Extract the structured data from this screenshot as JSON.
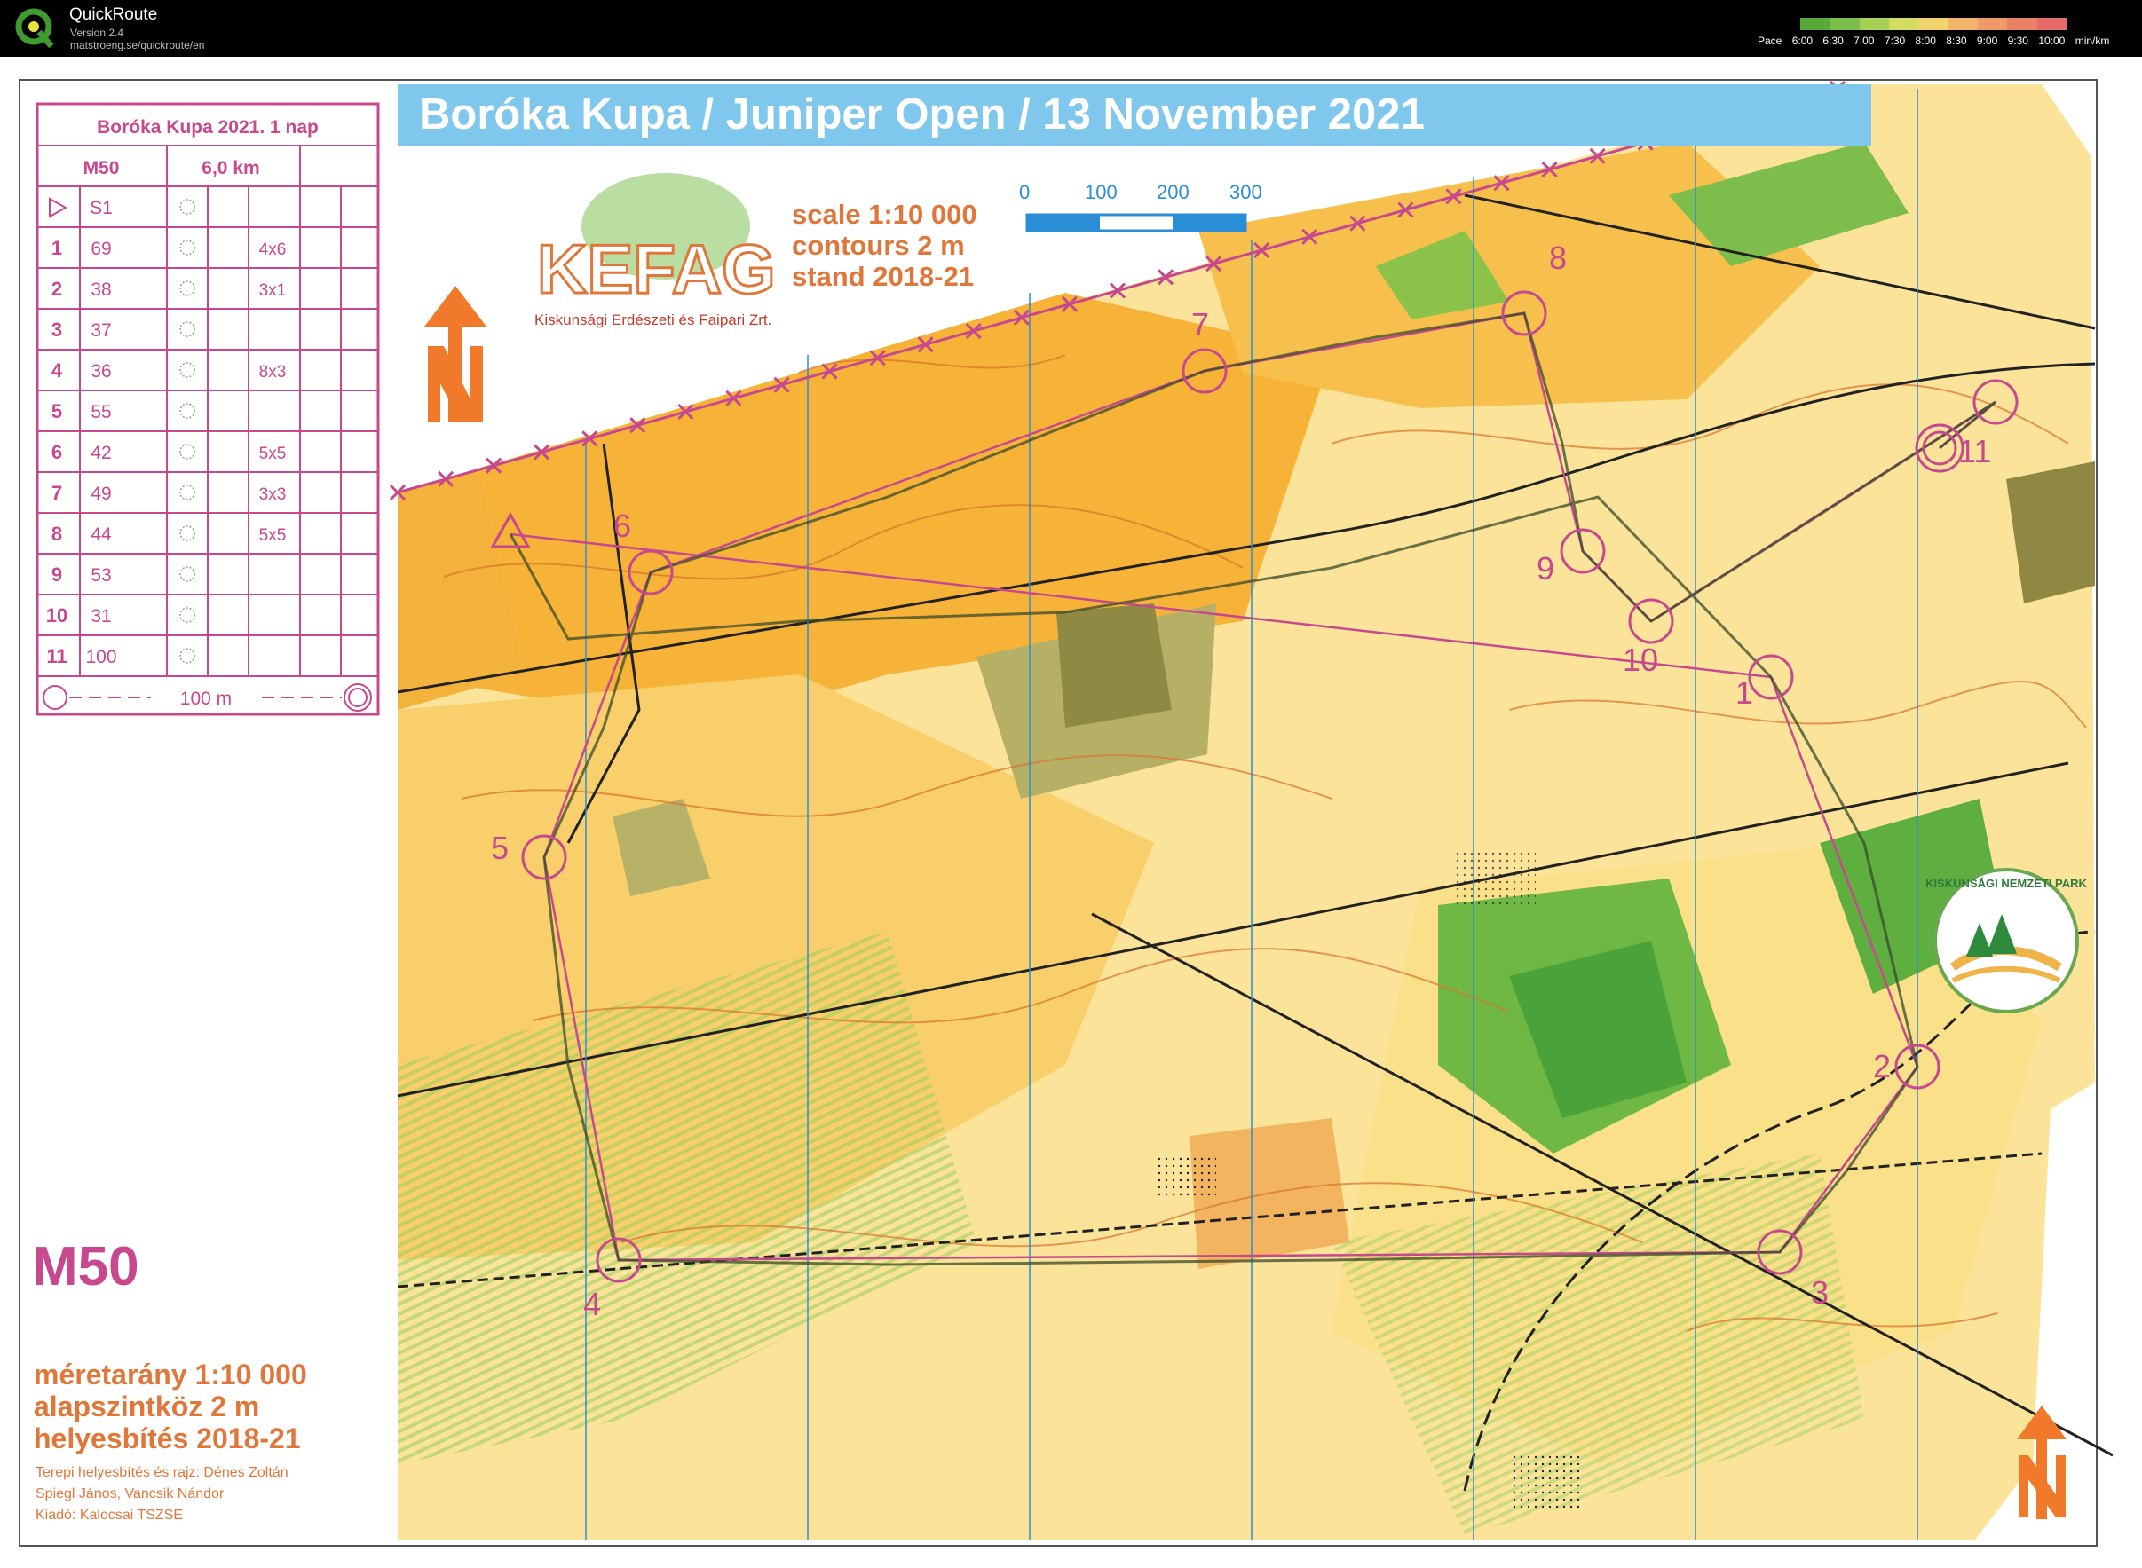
{
  "app": {
    "name": "QuickRoute",
    "version": "Version 2.4",
    "url": "matstroeng.se/quickroute/en"
  },
  "pace_legend": {
    "label": "Pace",
    "ticks": [
      "6:00",
      "6:30",
      "7:00",
      "7:30",
      "8:00",
      "8:30",
      "9:00",
      "9:30",
      "10:00"
    ],
    "unit": "min/km",
    "colors": [
      "#59a93a",
      "#7cbd4a",
      "#a6cf55",
      "#d2dc62",
      "#efd36b",
      "#f0b56b",
      "#ee9a69",
      "#ea8068",
      "#e56a6a"
    ]
  },
  "map": {
    "banner": "Boróka Kupa  /  Juniper Open  /  13 November 2021",
    "publisher_logo": "KEFAG",
    "publisher_name": "Kiskunsági Erdészeti és Faipari Zrt.",
    "scale_line1": "scale 1:10 000",
    "scale_line2": "contours   2 m",
    "scale_line3": "stand  2018-21",
    "scale_bar_ticks": [
      "0",
      "100",
      "200",
      "300"
    ],
    "class_label": "M50",
    "hu_scale1": "méretarány 1:10 000",
    "hu_scale2": "alapszintköz        2 m",
    "hu_scale3": "helyesbítés  2018-21",
    "credits1": "Terepi helyesbítés és rajz: Dénes Zoltán",
    "credits2": "Spiegl János, Vancsik Nándor",
    "credits3": "Kiadó: Kalocsai TSZSE",
    "park_logo": "KISKUNSÁGI NEMZETI PARK",
    "colors": {
      "orange": "#f6b338",
      "yellow": "#fbd66a",
      "green": "#8bc34a",
      "darkgreen": "#4aa33a",
      "purple": "#c8488e",
      "contour": "#d8732b",
      "blue": "#2a8ed6"
    }
  },
  "control_description": {
    "title": "Boróka Kupa 2021. 1 nap",
    "class": "M50",
    "distance": "6,0 km",
    "start_code": "S1",
    "rows": [
      {
        "n": "1",
        "code": "69",
        "size": "4x6"
      },
      {
        "n": "2",
        "code": "38",
        "size": "3x1"
      },
      {
        "n": "3",
        "code": "37",
        "size": ""
      },
      {
        "n": "4",
        "code": "36",
        "size": "8x3"
      },
      {
        "n": "5",
        "code": "55",
        "size": ""
      },
      {
        "n": "6",
        "code": "42",
        "size": "5x5"
      },
      {
        "n": "7",
        "code": "49",
        "size": "3x3"
      },
      {
        "n": "8",
        "code": "44",
        "size": "5x5"
      },
      {
        "n": "9",
        "code": "53",
        "size": ""
      },
      {
        "n": "10",
        "code": "31",
        "size": ""
      },
      {
        "n": "11",
        "code": "100",
        "size": ""
      }
    ],
    "finish": "100 m"
  },
  "controls": [
    "1",
    "2",
    "3",
    "4",
    "5",
    "6",
    "7",
    "8",
    "9",
    "10",
    "11"
  ]
}
